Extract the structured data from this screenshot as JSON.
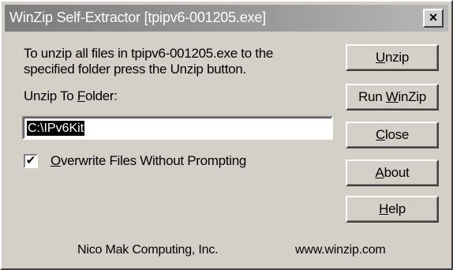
{
  "window": {
    "title": "WinZip Self-Extractor [tpipv6-001205.exe]",
    "close_glyph": "×"
  },
  "message": "To unzip all files in tpipv6-001205.exe to the specified folder press the Unzip button.",
  "folder": {
    "label_pre": "Unzip To ",
    "label_accel": "F",
    "label_post": "older:",
    "value": "C:\\IPv6Kit"
  },
  "overwrite": {
    "checked": true,
    "check_glyph": "✔",
    "label_accel": "O",
    "label_post": "verwrite Files Without Prompting"
  },
  "buttons": {
    "unzip": {
      "accel": "U",
      "rest": "nzip"
    },
    "run_winzip": {
      "pre": "Run ",
      "accel": "W",
      "rest": "inZip"
    },
    "close": {
      "accel": "C",
      "rest": "lose"
    },
    "about": {
      "accel": "A",
      "rest": "bout"
    },
    "help": {
      "accel": "H",
      "rest": "elp"
    }
  },
  "footer": {
    "company": "Nico Mak Computing, Inc.",
    "website": "www.winzip.com"
  },
  "colors": {
    "face": "#d4d0c8",
    "title_text": "#ffffff"
  }
}
